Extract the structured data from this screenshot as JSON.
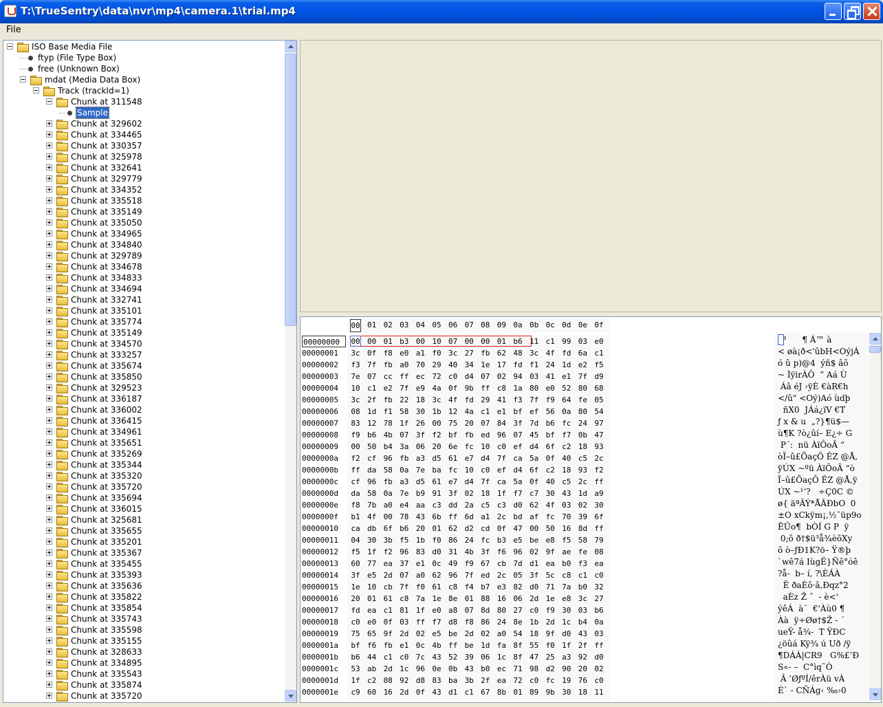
{
  "window": {
    "title": "T:\\TrueSentry\\data\\nvr\\mp4\\camera.1\\trial.mp4"
  },
  "menubar": {
    "file": "File"
  },
  "tree": {
    "nodes": [
      {
        "label": "ISO Base Media File",
        "kind": "folder",
        "expanded": true,
        "depth": 0
      },
      {
        "label": "ftyp (File Type Box)",
        "kind": "leaf",
        "depth": 1
      },
      {
        "label": "free (Unknown Box)",
        "kind": "leaf",
        "depth": 1
      },
      {
        "label": "mdat (Media Data Box)",
        "kind": "folder",
        "expanded": true,
        "depth": 1
      },
      {
        "label": "Track (trackId=1)",
        "kind": "folder",
        "expanded": true,
        "depth": 2
      },
      {
        "label": "Chunk at 311548",
        "kind": "folder",
        "expanded": true,
        "depth": 3
      },
      {
        "label": "Sample",
        "kind": "leaf",
        "depth": 4,
        "selected": true
      },
      {
        "label": "Chunk at 329602",
        "kind": "folder",
        "depth": 3
      },
      {
        "label": "Chunk at 334465",
        "kind": "folder",
        "depth": 3
      },
      {
        "label": "Chunk at 330357",
        "kind": "folder",
        "depth": 3
      },
      {
        "label": "Chunk at 325978",
        "kind": "folder",
        "depth": 3
      },
      {
        "label": "Chunk at 332641",
        "kind": "folder",
        "depth": 3
      },
      {
        "label": "Chunk at 329779",
        "kind": "folder",
        "depth": 3
      },
      {
        "label": "Chunk at 334352",
        "kind": "folder",
        "depth": 3
      },
      {
        "label": "Chunk at 335518",
        "kind": "folder",
        "depth": 3
      },
      {
        "label": "Chunk at 335149",
        "kind": "folder",
        "depth": 3
      },
      {
        "label": "Chunk at 335050",
        "kind": "folder",
        "depth": 3
      },
      {
        "label": "Chunk at 334965",
        "kind": "folder",
        "depth": 3
      },
      {
        "label": "Chunk at 334840",
        "kind": "folder",
        "depth": 3
      },
      {
        "label": "Chunk at 329789",
        "kind": "folder",
        "depth": 3
      },
      {
        "label": "Chunk at 334678",
        "kind": "folder",
        "depth": 3
      },
      {
        "label": "Chunk at 334833",
        "kind": "folder",
        "depth": 3
      },
      {
        "label": "Chunk at 334694",
        "kind": "folder",
        "depth": 3
      },
      {
        "label": "Chunk at 332741",
        "kind": "folder",
        "depth": 3
      },
      {
        "label": "Chunk at 335101",
        "kind": "folder",
        "depth": 3
      },
      {
        "label": "Chunk at 335774",
        "kind": "folder",
        "depth": 3
      },
      {
        "label": "Chunk at 335149",
        "kind": "folder",
        "depth": 3
      },
      {
        "label": "Chunk at 334570",
        "kind": "folder",
        "depth": 3
      },
      {
        "label": "Chunk at 333257",
        "kind": "folder",
        "depth": 3
      },
      {
        "label": "Chunk at 335674",
        "kind": "folder",
        "depth": 3
      },
      {
        "label": "Chunk at 335850",
        "kind": "folder",
        "depth": 3
      },
      {
        "label": "Chunk at 329523",
        "kind": "folder",
        "depth": 3
      },
      {
        "label": "Chunk at 336187",
        "kind": "folder",
        "depth": 3
      },
      {
        "label": "Chunk at 336002",
        "kind": "folder",
        "depth": 3
      },
      {
        "label": "Chunk at 336415",
        "kind": "folder",
        "depth": 3
      },
      {
        "label": "Chunk at 334961",
        "kind": "folder",
        "depth": 3
      },
      {
        "label": "Chunk at 335651",
        "kind": "folder",
        "depth": 3
      },
      {
        "label": "Chunk at 335269",
        "kind": "folder",
        "depth": 3
      },
      {
        "label": "Chunk at 335344",
        "kind": "folder",
        "depth": 3
      },
      {
        "label": "Chunk at 335320",
        "kind": "folder",
        "depth": 3
      },
      {
        "label": "Chunk at 335720",
        "kind": "folder",
        "depth": 3
      },
      {
        "label": "Chunk at 335694",
        "kind": "folder",
        "depth": 3
      },
      {
        "label": "Chunk at 336015",
        "kind": "folder",
        "depth": 3
      },
      {
        "label": "Chunk at 325681",
        "kind": "folder",
        "depth": 3
      },
      {
        "label": "Chunk at 335655",
        "kind": "folder",
        "depth": 3
      },
      {
        "label": "Chunk at 335201",
        "kind": "folder",
        "depth": 3
      },
      {
        "label": "Chunk at 335367",
        "kind": "folder",
        "depth": 3
      },
      {
        "label": "Chunk at 335455",
        "kind": "folder",
        "depth": 3
      },
      {
        "label": "Chunk at 335393",
        "kind": "folder",
        "depth": 3
      },
      {
        "label": "Chunk at 335636",
        "kind": "folder",
        "depth": 3
      },
      {
        "label": "Chunk at 335822",
        "kind": "folder",
        "depth": 3
      },
      {
        "label": "Chunk at 335854",
        "kind": "folder",
        "depth": 3
      },
      {
        "label": "Chunk at 335743",
        "kind": "folder",
        "depth": 3
      },
      {
        "label": "Chunk at 335598",
        "kind": "folder",
        "depth": 3
      },
      {
        "label": "Chunk at 335155",
        "kind": "folder",
        "depth": 3
      },
      {
        "label": "Chunk at 328633",
        "kind": "folder",
        "depth": 3
      },
      {
        "label": "Chunk at 334895",
        "kind": "folder",
        "depth": 3
      },
      {
        "label": "Chunk at 335543",
        "kind": "folder",
        "depth": 3
      },
      {
        "label": "Chunk at 335874",
        "kind": "folder",
        "depth": 3
      },
      {
        "label": "Chunk at 335720",
        "kind": "folder",
        "depth": 3
      }
    ]
  },
  "hex": {
    "header": [
      "00",
      "01",
      "02",
      "03",
      "04",
      "05",
      "06",
      "07",
      "08",
      "09",
      "0a",
      "0b",
      "0c",
      "0d",
      "0e",
      "0f"
    ],
    "rows": [
      {
        "offset": "00000000",
        "bytes": "00 00 01 b3 00 10 07 00 00 01 b6 11 c1 99 03 e0",
        "ascii": "  ³      ¶ Á™ à"
      },
      {
        "offset": "00000001",
        "bytes": "3c 0f f8 e0 a1 f0 3c 27 fb 62 48 3c 4f fd 6a c1",
        "ascii": "< øà¡ð<'ûbH<OýjÁ"
      },
      {
        "offset": "00000002",
        "bytes": "f3 7f fb a0 70 29 40 34 1e 17 fd f1 24 1d e2 f5",
        "ascii": "ó û p)@4  ýñ$ âõ"
      },
      {
        "offset": "00000003",
        "bytes": "7e 07 cc ff ec 72 c0 d4 07 02 94 03 41 e1 7f d9",
        "ascii": "~ ÌÿìrÀÔ  ” Aá Ù"
      },
      {
        "offset": "00000004",
        "bytes": "10 c1 e2 7f e9 4a 0f 9b ff c8 1a 80 e0 52 80 68",
        "ascii": " Áâ éJ ›ÿÈ €àR€h"
      },
      {
        "offset": "00000005",
        "bytes": "3c 2f fb 22 18 3c 4f fd 29 41 f3 7f f9 64 fe 05",
        "ascii": "</û\" <Oý)Aó ùdþ "
      },
      {
        "offset": "00000006",
        "bytes": "08 1d f1 58 30 1b 12 4a c1 e1 bf ef 56 0a 80 54",
        "ascii": "  ñX0  JÁá¿ïV €T"
      },
      {
        "offset": "00000007",
        "bytes": "83 12 78 1f 26 00 75 20 07 84 3f 7d b6 fc 24 97",
        "ascii": "ƒ x & u  „?}¶ü$—"
      },
      {
        "offset": "00000008",
        "bytes": "f9 b6 4b 07 3f f2 bf fb ed 96 07 45 bf f7 0b 47",
        "ascii": "ù¶K ?ò¿ûí– E¿÷ G"
      },
      {
        "offset": "00000009",
        "bytes": "00 50 b4 3a 06 20 6e fc 10 c0 ef d4 6f c2 18 93",
        "ascii": " P´:  nü ÀïÔoÂ “"
      },
      {
        "offset": "0000000a",
        "bytes": "f2 cf 96 fb a3 d5 61 e7 d4 7f ca 5a 0f 40 c5 2c",
        "ascii": "òÏ–û£ÕaçÔ ÊZ @Å,"
      },
      {
        "offset": "0000000b",
        "bytes": "ff da 58 0a 7e ba fc 10 c0 ef d4 6f c2 18 93 f2",
        "ascii": "ÿÚX ~ºü ÀïÔoÂ “ò"
      },
      {
        "offset": "0000000c",
        "bytes": "cf 96 fb a3 d5 61 e7 d4 7f ca 5a 0f 40 c5 2c ff",
        "ascii": "Ï–û£ÕaçÔ ÊZ @Å,ÿ"
      },
      {
        "offset": "0000000d",
        "bytes": "da 58 0a 7e b9 91 3f 02 18 1f f7 c7 30 43 1d a9",
        "ascii": "ÚX ~¹‘?   ÷Ç0C ©"
      },
      {
        "offset": "0000000e",
        "bytes": "f8 7b a0 e4 aa c3 dd 2a c5 c3 d0 62 4f 03 02 30",
        "ascii": "ø{ äªÃÝ*ÅÃÐbO  0"
      },
      {
        "offset": "0000000f",
        "bytes": "b1 4f 00 78 43 6b ff 6d a1 2c bd af fc 70 39 6f",
        "ascii": "±O xCkÿm¡,½¯üp9o"
      },
      {
        "offset": "00000010",
        "bytes": "ca db 6f b6 20 01 62 d2 cd 0f 47 00 50 16 8d ff",
        "ascii": "ÊÛo¶  bÒÍ G P  ÿ"
      },
      {
        "offset": "00000011",
        "bytes": "04 30 3b f5 1b f0 86 24 fc b3 e5 be e8 f5 58 79",
        "ascii": " 0;õ ð†$ü³å¾èõXy"
      },
      {
        "offset": "00000012",
        "bytes": "f5 1f f2 96 83 d0 31 4b 3f f6 96 02 9f ae fe 08",
        "ascii": "õ ò–ƒÐ1K?ö– Ÿ®þ "
      },
      {
        "offset": "00000013",
        "bytes": "60 77 ea 37 e1 0c 49 f9 67 cb 7d d1 ea b0 f3 ea",
        "ascii": "`wê7á IùgË}Ñê°óê"
      },
      {
        "offset": "00000014",
        "bytes": "3f e5 2d 07 a0 62 96 7f ed 2c 05 3f 5c c8 c1 c0",
        "ascii": "?å-  b– í, ?\\ÈÁÀ"
      },
      {
        "offset": "00000015",
        "bytes": "1e 10 cb 7f f0 61 c8 f4 b7 e3 82 d0 71 7a b0 32",
        "ascii": "  Ë ðaÈô·ã‚Ðqz°2"
      },
      {
        "offset": "00000016",
        "bytes": "20 01 61 c8 7a 1e 8e 01 88 16 06 2d 1e e8 3c 27",
        "ascii": "  aÈz Ž ˆ  - è<'"
      },
      {
        "offset": "00000017",
        "bytes": "fd ea c1 81 1f e0 a8 07 8d 80 27 c0 f9 30 03 b6",
        "ascii": "ýêÁ  à¨  €'Àù0 ¶"
      },
      {
        "offset": "00000018",
        "bytes": "c0 e0 0f 03 ff f7 d8 f8 86 24 8e 1b 2d 1c b4 0a",
        "ascii": "Àà  ÿ÷Øø†$Ž - ´ "
      },
      {
        "offset": "00000019",
        "bytes": "75 65 9f 2d 02 e5 be 2d 02 a0 54 18 9f d0 43 03",
        "ascii": "ueŸ- å¾-  T ŸÐC "
      },
      {
        "offset": "0000001a",
        "bytes": "bf f6 fb e1 0c 4b ff be 1d fa 8f 55 f0 1f 2f ff",
        "ascii": "¿öûá Kÿ¾ ú Uð /ÿ"
      },
      {
        "offset": "0000001b",
        "bytes": "b6 44 c1 c0 7c 43 52 39 06 1c 8f 47 25 a3 92 d0",
        "ascii": "¶DÁÀ|CR9   G%£’Ð"
      },
      {
        "offset": "0000001c",
        "bytes": "53 ab 2d 1c 96 0e 0b 43 b0 ec 71 98 d2 90 20 02",
        "ascii": "S«- –  C°ìq˜Ò   "
      },
      {
        "offset": "0000001d",
        "bytes": "1f c2 08 92 d8 83 ba 3b 2f ea 72 c0 fc 19 76 c0",
        "ascii": " Â ’ØƒºÍ/êrÀü vÀ"
      },
      {
        "offset": "0000001e",
        "bytes": "c9 60 16 2d 0f 43 d1 c1 67 8b 01 89 9b 30 18 11",
        "ascii": "É` - CÑÁg‹ ‰›0  "
      }
    ]
  }
}
